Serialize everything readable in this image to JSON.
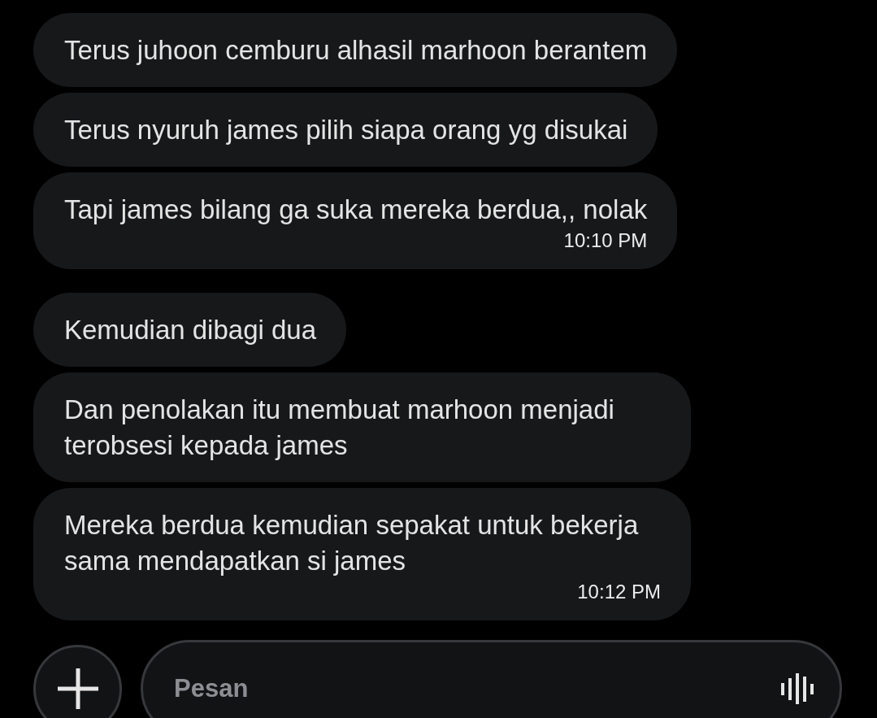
{
  "message_groups": [
    {
      "messages": [
        {
          "text": "Terus juhoon cemburu alhasil marhoon berantem"
        },
        {
          "text": "Terus nyuruh james pilih siapa orang yg disukai"
        },
        {
          "text": "Tapi james bilang ga suka mereka berdua,, nolak",
          "time": "10:10 PM"
        }
      ]
    },
    {
      "messages": [
        {
          "text": "Kemudian dibagi dua"
        },
        {
          "text": "Dan penolakan itu membuat marhoon menjadi terobsesi kepada james"
        },
        {
          "text": "Mereka berdua kemudian sepakat untuk bekerja sama mendapatkan si james",
          "time": "10:12 PM"
        }
      ]
    }
  ],
  "composer": {
    "placeholder": "Pesan"
  }
}
